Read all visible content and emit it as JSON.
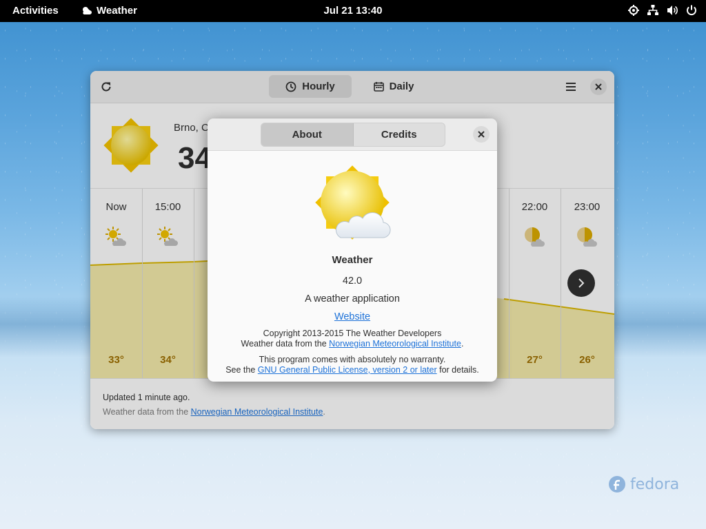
{
  "topbar": {
    "activities": "Activities",
    "app_name": "Weather",
    "clock": "Jul 21  13:40",
    "tray_icons": [
      "location-icon",
      "network-icon",
      "volume-icon",
      "power-icon"
    ]
  },
  "window": {
    "tabs": [
      {
        "label": "Hourly",
        "icon": "clock-icon",
        "active": true
      },
      {
        "label": "Daily",
        "icon": "calendar-icon",
        "active": false
      }
    ],
    "current": {
      "city": "Brno, C",
      "temp": "34"
    },
    "hours": [
      {
        "time": "Now",
        "temp": "33°",
        "icon": "sun-cloud-icon"
      },
      {
        "time": "15:00",
        "temp": "34°",
        "icon": "sun-cloud-icon"
      },
      {
        "time": "22:00",
        "temp": "27°",
        "icon": "moon-cloud-icon"
      },
      {
        "time": "23:00",
        "temp": "26°",
        "icon": "moon-cloud-icon"
      }
    ],
    "footer": {
      "updated": "Updated 1 minute ago.",
      "attribution_prefix": "Weather data from the ",
      "attribution_link": "Norwegian Meteorological Institute",
      "attribution_suffix": "."
    }
  },
  "about": {
    "tabs": [
      {
        "label": "About",
        "active": true
      },
      {
        "label": "Credits",
        "active": false
      }
    ],
    "app_name": "Weather",
    "version": "42.0",
    "description": "A weather application",
    "website": "Website",
    "copyright": "Copyright 2013-2015 The Weather Developers",
    "data_prefix": "Weather data from the ",
    "data_link": "Norwegian Meteorological Institute",
    "data_suffix": ".",
    "warranty": "This program comes with absolutely no warranty.",
    "license_prefix": "See the ",
    "license_link": "GNU General Public License, version 2 or later",
    "license_suffix": " for details."
  },
  "desktop": {
    "brand": "fedora"
  },
  "colors": {
    "accent": "#1c71d8",
    "temp_text": "#9c6e00",
    "graph_fill": "#f0e6a8",
    "graph_line": "#d8b400"
  }
}
